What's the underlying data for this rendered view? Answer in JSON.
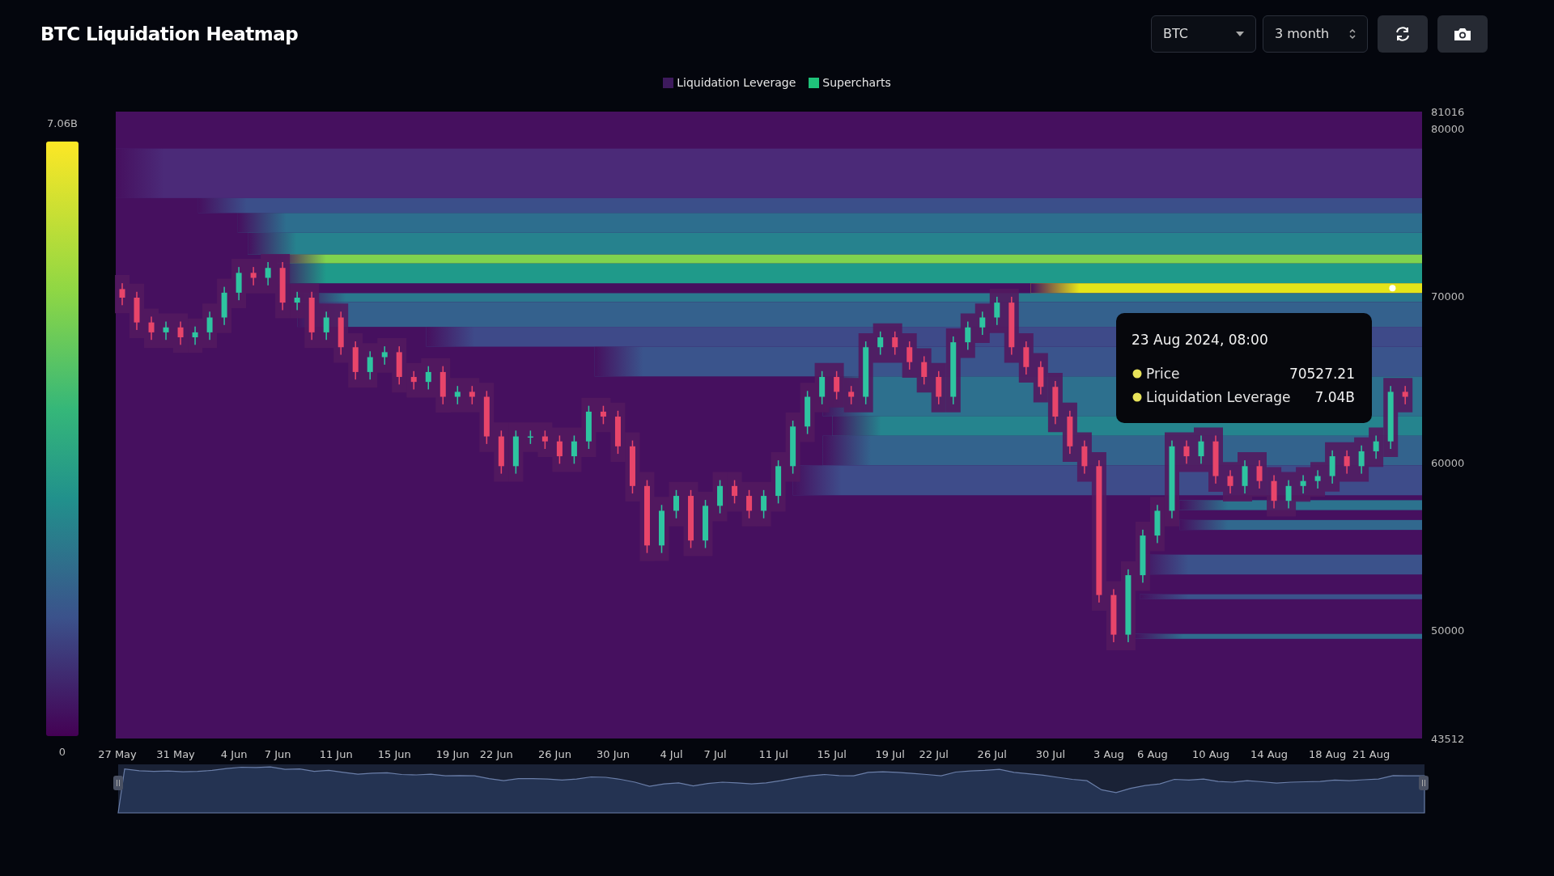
{
  "header": {
    "title": "BTC Liquidation Heatmap",
    "coin_select": {
      "value": "BTC"
    },
    "range_select": {
      "value": "3 month"
    }
  },
  "legend": [
    {
      "label": "Liquidation Leverage",
      "color": "#3d1a5c"
    },
    {
      "label": "Supercharts",
      "color": "#1fc27a"
    }
  ],
  "color_scale": {
    "max_label": "7.06B",
    "min_label": "0"
  },
  "chart": {
    "chart_data": {
      "type": "candlestick",
      "ylim": [
        43512,
        81016
      ],
      "yticks": [
        {
          "value": 81016,
          "label": "81016"
        },
        {
          "value": 80000,
          "label": "80000"
        },
        {
          "value": 70000,
          "label": "70000"
        },
        {
          "value": 60000,
          "label": "60000"
        },
        {
          "value": 50000,
          "label": "50000"
        },
        {
          "value": 43512,
          "label": "43512"
        }
      ],
      "categories": [
        "27 May",
        null,
        null,
        null,
        "31 May",
        null,
        null,
        null,
        "4 Jun",
        null,
        null,
        "7 Jun",
        null,
        null,
        null,
        "11 Jun",
        null,
        null,
        null,
        "15 Jun",
        null,
        null,
        null,
        "19 Jun",
        null,
        null,
        "22 Jun",
        null,
        null,
        null,
        "26 Jun",
        null,
        null,
        null,
        "30 Jun",
        null,
        null,
        null,
        "4 Jul",
        null,
        null,
        "7 Jul",
        null,
        null,
        null,
        "11 Jul",
        null,
        null,
        null,
        "15 Jul",
        null,
        null,
        null,
        "19 Jul",
        null,
        null,
        "22 Jul",
        null,
        null,
        null,
        "26 Jul",
        null,
        null,
        null,
        "30 Jul",
        null,
        null,
        null,
        "3 Aug",
        null,
        null,
        "6 Aug",
        null,
        null,
        null,
        "10 Aug",
        null,
        null,
        null,
        "14 Aug",
        null,
        null,
        null,
        "18 Aug",
        null,
        null,
        "21 Aug",
        null,
        null
      ],
      "ohlc": [
        [
          70400,
          70750,
          69436,
          69886
        ],
        [
          69886,
          70236,
          67953,
          68403
        ],
        [
          68403,
          68753,
          67360,
          67810
        ],
        [
          67810,
          68457,
          67360,
          68107
        ],
        [
          68107,
          68457,
          67064,
          67514
        ],
        [
          67514,
          68160,
          67064,
          67810
        ],
        [
          67810,
          69050,
          67360,
          68700
        ],
        [
          68700,
          70533,
          68250,
          70183
        ],
        [
          70183,
          71719,
          69733,
          71369
        ],
        [
          71369,
          71719,
          70622,
          71072
        ],
        [
          71072,
          72015,
          70622,
          71665
        ],
        [
          71665,
          72015,
          69140,
          69590
        ],
        [
          69590,
          70236,
          69140,
          69886
        ],
        [
          69886,
          70236,
          67360,
          67810
        ],
        [
          67810,
          69050,
          67360,
          68700
        ],
        [
          68700,
          69050,
          66471,
          66921
        ],
        [
          66921,
          67271,
          64988,
          65438
        ],
        [
          65438,
          66678,
          64988,
          66328
        ],
        [
          66328,
          66975,
          65878,
          66625
        ],
        [
          66625,
          66975,
          64692,
          65142
        ],
        [
          65142,
          65492,
          64395,
          64845
        ],
        [
          64845,
          65788,
          64395,
          65438
        ],
        [
          65438,
          65788,
          63506,
          63956
        ],
        [
          63956,
          64602,
          63506,
          64252
        ],
        [
          64252,
          64602,
          63506,
          63956
        ],
        [
          63956,
          64306,
          61134,
          61584
        ],
        [
          61584,
          61934,
          59355,
          59805
        ],
        [
          59805,
          61934,
          59355,
          61584
        ],
        [
          61584,
          61934,
          61134,
          61584
        ],
        [
          61584,
          61934,
          60837,
          61287
        ],
        [
          61287,
          61637,
          59948,
          60398
        ],
        [
          60398,
          61637,
          59948,
          61287
        ],
        [
          61287,
          63416,
          60837,
          63066
        ],
        [
          63066,
          63416,
          62320,
          62770
        ],
        [
          62770,
          63120,
          60541,
          60991
        ],
        [
          60991,
          61341,
          58169,
          58619
        ],
        [
          58619,
          58969,
          54611,
          55061
        ],
        [
          55061,
          57486,
          54611,
          57136
        ],
        [
          57136,
          58376,
          56686,
          58026
        ],
        [
          58026,
          58376,
          54907,
          55357
        ],
        [
          55357,
          57783,
          54907,
          57433
        ],
        [
          57433,
          58969,
          56983,
          58619
        ],
        [
          58619,
          58969,
          57576,
          58026
        ],
        [
          58026,
          58376,
          56686,
          57136
        ],
        [
          57136,
          58376,
          56686,
          58026
        ],
        [
          58026,
          60155,
          57576,
          59805
        ],
        [
          59805,
          62527,
          59355,
          62177
        ],
        [
          62177,
          64306,
          61727,
          63956
        ],
        [
          63956,
          65492,
          63506,
          65142
        ],
        [
          65142,
          65492,
          63802,
          64252
        ],
        [
          64252,
          64602,
          63506,
          63956
        ],
        [
          63956,
          67271,
          63506,
          66921
        ],
        [
          66921,
          67864,
          66471,
          67514
        ],
        [
          67514,
          67864,
          66471,
          66921
        ],
        [
          66921,
          67271,
          65581,
          66031
        ],
        [
          66031,
          66381,
          64692,
          65142
        ],
        [
          65142,
          65492,
          63506,
          63956
        ],
        [
          63956,
          67567,
          63506,
          67217
        ],
        [
          67217,
          68457,
          66767,
          68107
        ],
        [
          68107,
          69050,
          67657,
          68700
        ],
        [
          68700,
          69940,
          68250,
          69590
        ],
        [
          69590,
          69940,
          66471,
          66921
        ],
        [
          66921,
          67271,
          65285,
          65735
        ],
        [
          65735,
          66085,
          64099,
          64549
        ],
        [
          64549,
          64899,
          62320,
          62770
        ],
        [
          62770,
          63120,
          60541,
          60991
        ],
        [
          60991,
          61341,
          59355,
          59805
        ],
        [
          59805,
          60155,
          51646,
          52096
        ],
        [
          52096,
          52446,
          49274,
          49724
        ],
        [
          49724,
          53632,
          49274,
          53282
        ],
        [
          53282,
          56004,
          52832,
          55654
        ],
        [
          55654,
          57486,
          55204,
          57136
        ],
        [
          57136,
          61341,
          56686,
          60991
        ],
        [
          60991,
          61341,
          59948,
          60398
        ],
        [
          60398,
          61637,
          59948,
          61287
        ],
        [
          61287,
          61637,
          58762,
          59212
        ],
        [
          59212,
          59562,
          58169,
          58619
        ],
        [
          58619,
          60155,
          58169,
          59805
        ],
        [
          59805,
          60155,
          58466,
          58916
        ],
        [
          58916,
          59266,
          57280,
          57730
        ],
        [
          57730,
          58969,
          57280,
          58619
        ],
        [
          58619,
          59266,
          58169,
          58916
        ],
        [
          58916,
          59562,
          58466,
          59212
        ],
        [
          59212,
          60748,
          58762,
          60398
        ],
        [
          60398,
          60748,
          59355,
          59805
        ],
        [
          59805,
          61044,
          59355,
          60694
        ],
        [
          60694,
          61637,
          60244,
          61287
        ],
        [
          61287,
          64602,
          60837,
          64252
        ],
        [
          64252,
          64602,
          63506,
          63956
        ]
      ]
    },
    "tooltip": {
      "title": "23 Aug 2024, 08:00",
      "rows": [
        {
          "label": "Price",
          "value": "70527.21"
        },
        {
          "label": "Liquidation Leverage",
          "value": "7.04B"
        }
      ]
    }
  }
}
